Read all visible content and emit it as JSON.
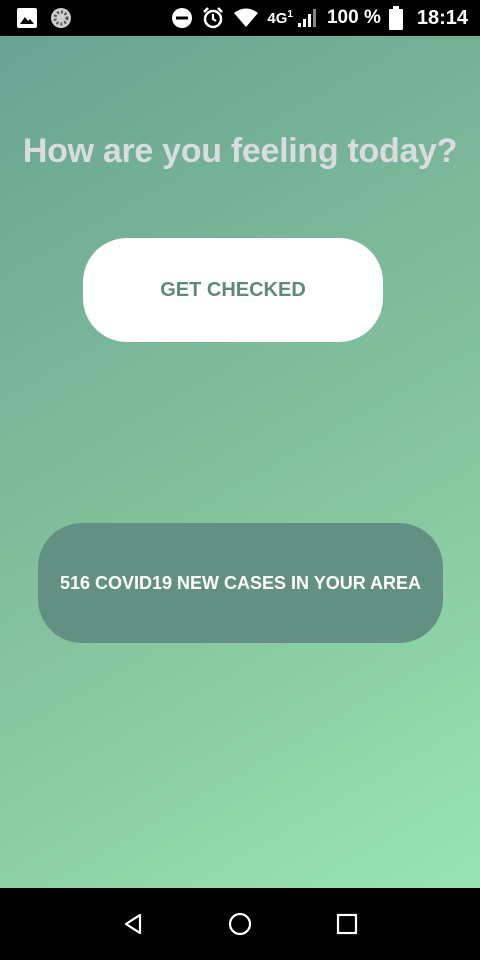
{
  "status_bar": {
    "network": "4G",
    "network_sup": "1",
    "battery": "100 %",
    "time": "18:14",
    "icons": [
      "image-icon",
      "sync-icon",
      "do-not-disturb-icon",
      "alarm-icon",
      "wifi-icon",
      "signal-icon",
      "battery-icon"
    ]
  },
  "main": {
    "headline": "How are you feeling today?",
    "check_button_label": "GET CHECKED",
    "cases_text": "516 COVID19 NEW CASES IN YOUR AREA"
  },
  "colors": {
    "gradient_start": "#6aa393",
    "gradient_end": "#99e5b2",
    "cases_card": "#629184",
    "check_label": "#5e8a7e",
    "headline": "#d9dde0"
  },
  "nav_bar": {
    "icons": [
      "back-icon",
      "home-icon",
      "recents-icon"
    ]
  }
}
